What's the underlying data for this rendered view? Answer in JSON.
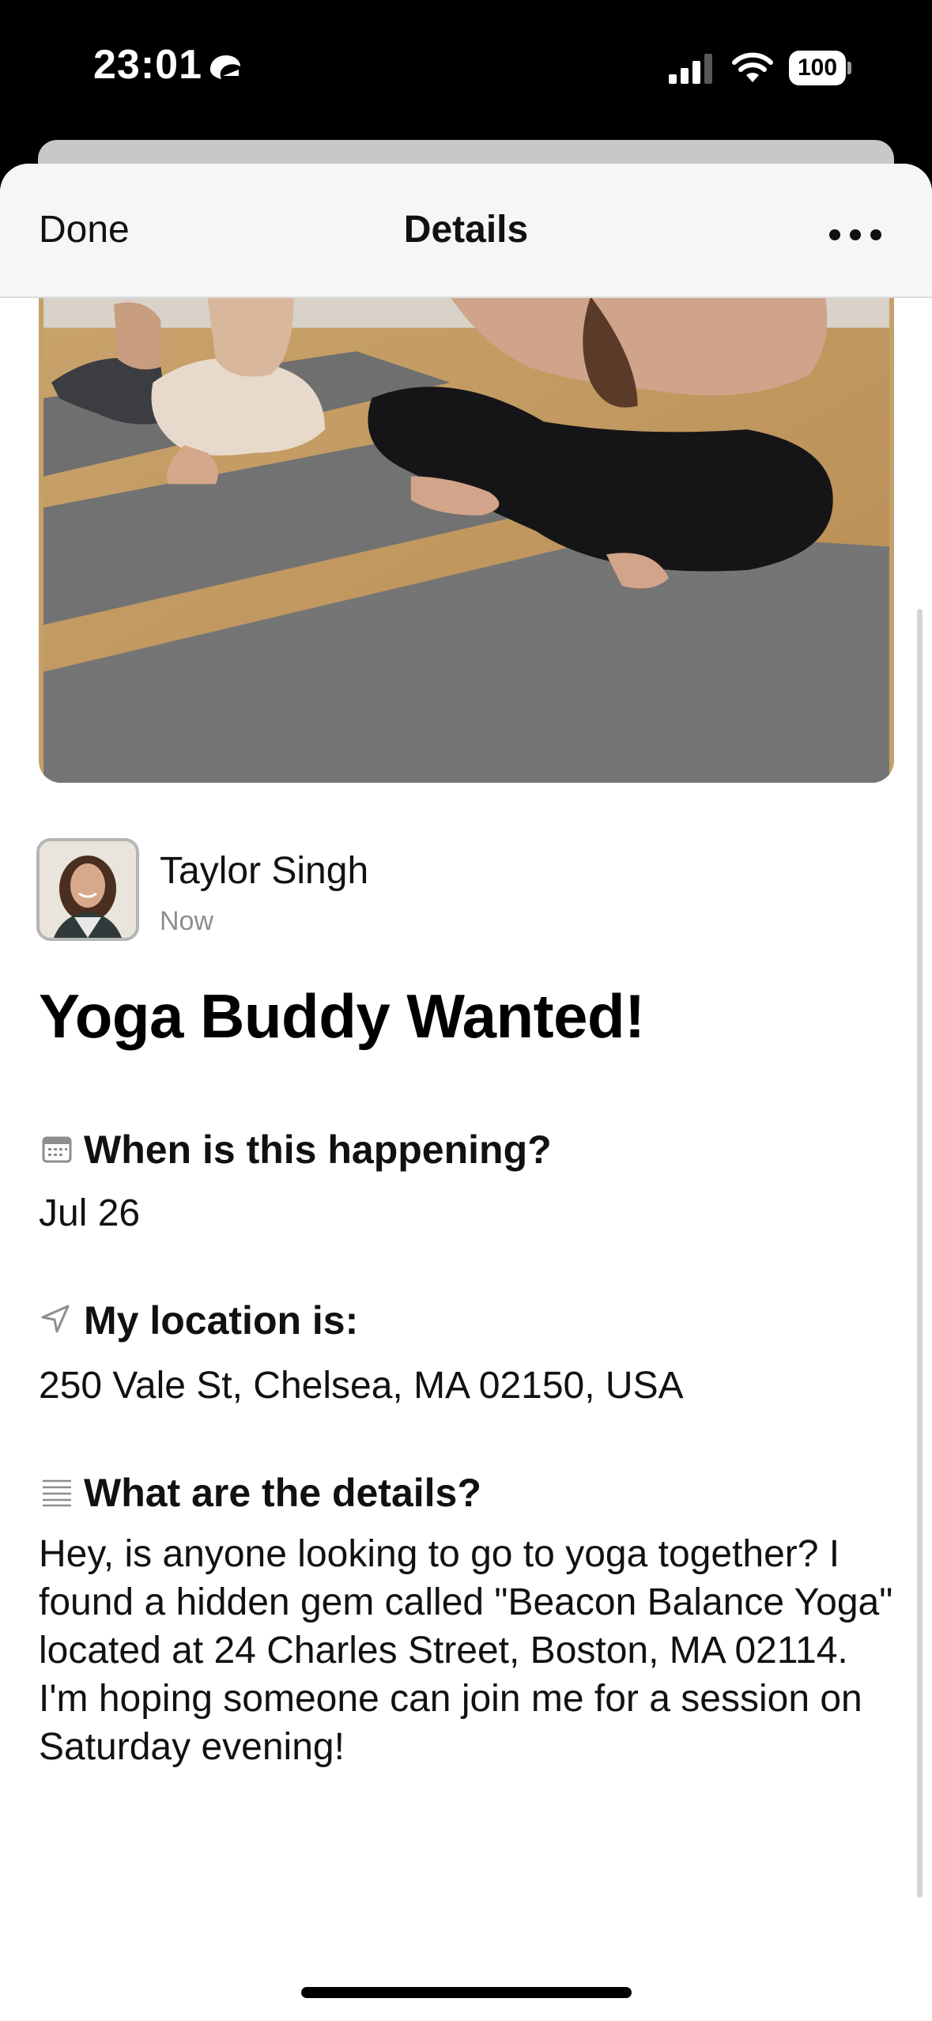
{
  "status_bar": {
    "time": "23:01",
    "battery": "100",
    "icons": [
      "focus-sleep-icon",
      "cellular-signal-icon",
      "wifi-icon",
      "battery-icon"
    ]
  },
  "nav": {
    "done_label": "Done",
    "title": "Details",
    "more_icon": "ellipsis-icon"
  },
  "post": {
    "image": "yoga-class-photo",
    "author": {
      "name": "Taylor Singh",
      "time": "Now"
    },
    "title": "Yoga Buddy Wanted!",
    "sections": [
      {
        "icon": "calendar-icon",
        "heading": "When is this happening?",
        "value": "Jul 26"
      },
      {
        "icon": "location-arrow-icon",
        "heading": "My location is:",
        "value": "250 Vale St, Chelsea, MA 02150, USA"
      },
      {
        "icon": "text-lines-icon",
        "heading": "What are the details?",
        "value": "Hey, is anyone looking to go to yoga together? I found a hidden gem called \"Beacon Balance Yoga\" located at 24 Charles Street, Boston, MA 02114. I'm hoping someone can join me for a session on Saturday evening!"
      }
    ]
  },
  "colors": {
    "nav_background": "#f6f6f6",
    "text_primary": "#111111",
    "text_secondary": "#8e8e8e",
    "icon_gray": "#8e8e8e"
  }
}
